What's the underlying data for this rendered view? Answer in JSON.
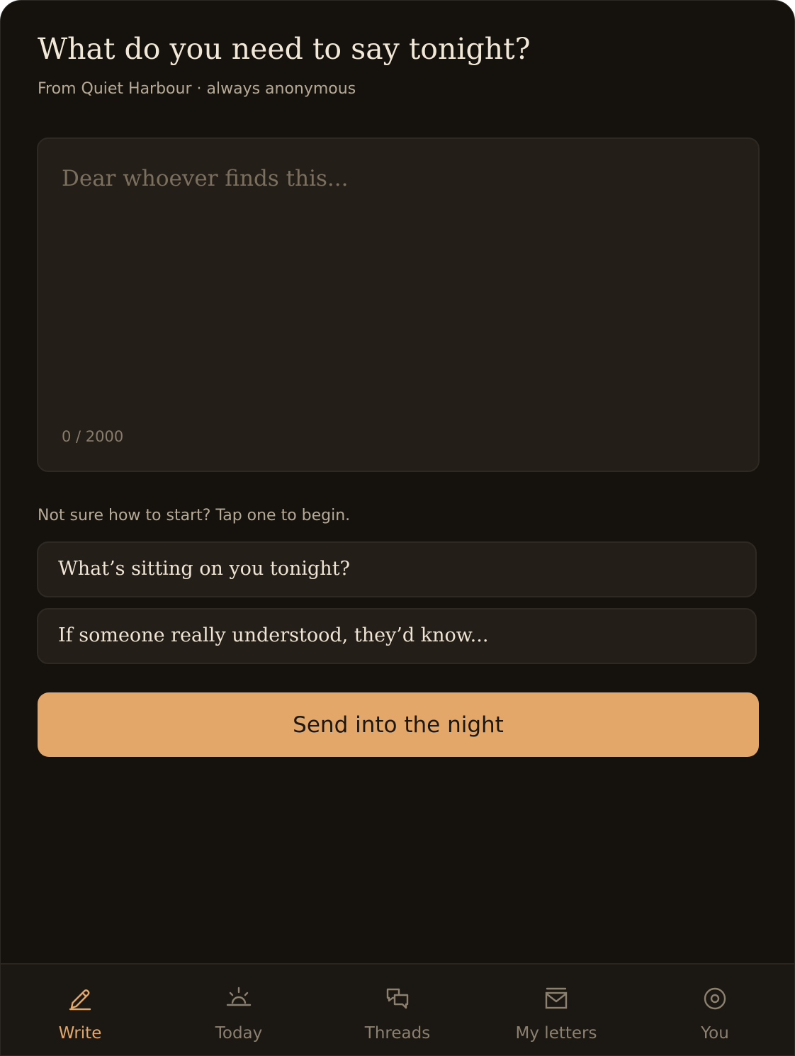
{
  "header": {
    "title": "What do you need to say tonight?",
    "subtitle": "From Quiet Harbour · always anonymous"
  },
  "composer": {
    "value": "",
    "placeholder": "Dear whoever finds this...",
    "counter": "0 / 2000"
  },
  "prompts": {
    "hint": "Not sure how to start? Tap one to begin.",
    "items": [
      "What’s sitting on you tonight?",
      "If someone really understood, they’d know..."
    ]
  },
  "send": {
    "label": "Send into the night"
  },
  "nav": {
    "active": "Write",
    "items": [
      {
        "label": "Write",
        "icon": "pencil-icon"
      },
      {
        "label": "Today",
        "icon": "sunrise-icon"
      },
      {
        "label": "Threads",
        "icon": "chat-bubbles-icon"
      },
      {
        "label": "My letters",
        "icon": "mailbox-icon"
      },
      {
        "label": "You",
        "icon": "profile-circle-icon"
      }
    ]
  },
  "colors": {
    "background": "#15120e",
    "surface": "#241e19",
    "accent": "#e3a769",
    "text": "#f1e8d8",
    "muted": "#b6aa97"
  }
}
